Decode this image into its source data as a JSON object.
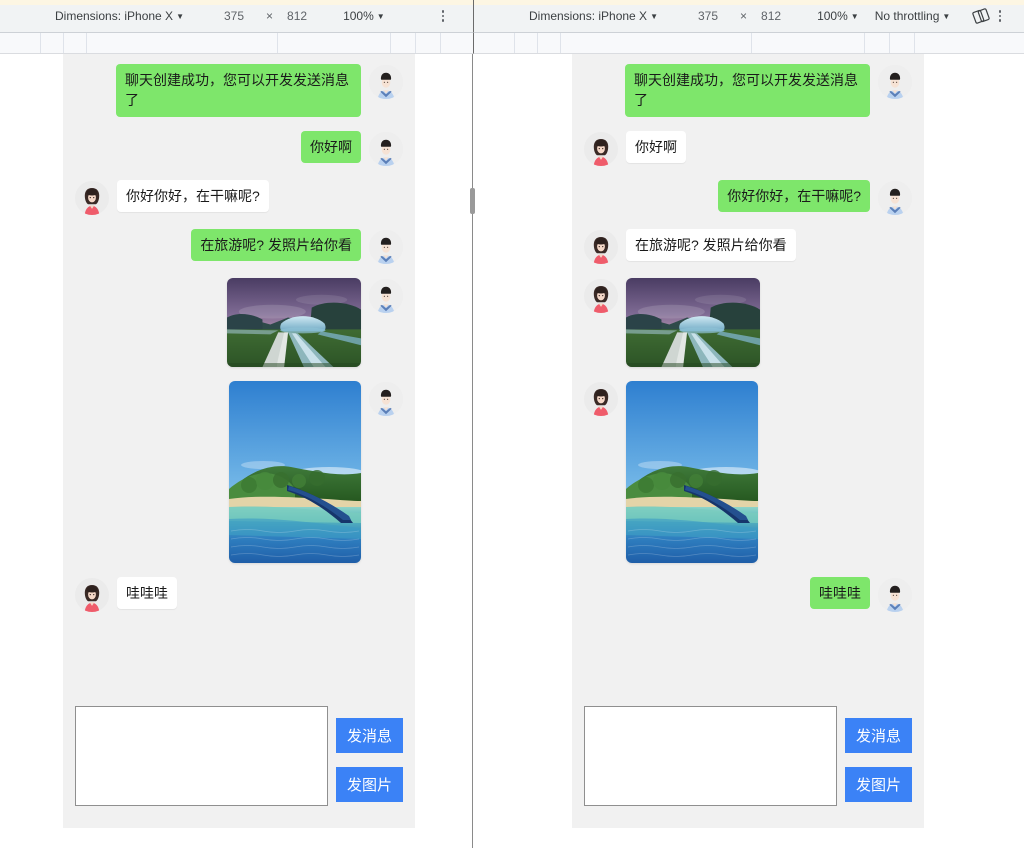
{
  "toolbars": {
    "left": {
      "dimensions_label": "Dimensions: iPhone X",
      "width": "375",
      "times": "×",
      "height": "812",
      "zoom": "100%",
      "menu_icon": "kebab-menu-icon"
    },
    "right": {
      "dimensions_label": "Dimensions: iPhone X",
      "width": "375",
      "times": "×",
      "height": "812",
      "zoom": "100%",
      "throttling": "No throttling",
      "rotate_icon": "rotate-device-icon",
      "menu_icon": "kebab-menu-icon"
    }
  },
  "colors": {
    "sent_bubble": "#7ee66b",
    "recv_bubble": "#ffffff",
    "button_blue": "#3b82f6",
    "chat_background": "#f1f1f1",
    "toolbar_background": "#f1f3f4"
  },
  "composer": {
    "input_value": "",
    "input_placeholder": "",
    "send_message_label": "发消息",
    "send_image_label": "发图片"
  },
  "panes": [
    {
      "id": "left-pane",
      "role": "sender-view",
      "messages": [
        {
          "text": "聊天创建成功，您可以开发发送消息了",
          "side": "sent",
          "type": "text",
          "avatar": "male-avatar"
        },
        {
          "text": "你好啊",
          "side": "sent",
          "type": "text",
          "avatar": "male-avatar"
        },
        {
          "text": "你好你好，在干嘛呢?",
          "side": "recv",
          "type": "text",
          "avatar": "female-avatar"
        },
        {
          "text": "在旅游呢? 发照片给你看",
          "side": "sent",
          "type": "text",
          "avatar": "male-avatar"
        },
        {
          "text": "",
          "side": "sent",
          "type": "image",
          "image": "dusk-landscape-photo",
          "avatar": "male-avatar"
        },
        {
          "text": "",
          "side": "sent",
          "type": "image",
          "image": "tropical-beach-photo",
          "avatar": "male-avatar"
        },
        {
          "text": "哇哇哇",
          "side": "recv",
          "type": "text",
          "avatar": "female-avatar"
        }
      ]
    },
    {
      "id": "right-pane",
      "role": "receiver-view",
      "messages": [
        {
          "text": "聊天创建成功，您可以开发发送消息了",
          "side": "sent",
          "type": "text",
          "avatar": "male-avatar"
        },
        {
          "text": "你好啊",
          "side": "recv",
          "type": "text",
          "avatar": "female-avatar"
        },
        {
          "text": "你好你好，在干嘛呢?",
          "side": "sent",
          "type": "text",
          "avatar": "male-avatar"
        },
        {
          "text": "在旅游呢? 发照片给你看",
          "side": "recv",
          "type": "text",
          "avatar": "female-avatar"
        },
        {
          "text": "",
          "side": "recv",
          "type": "image",
          "image": "dusk-landscape-photo",
          "avatar": "female-avatar"
        },
        {
          "text": "",
          "side": "recv",
          "type": "image",
          "image": "tropical-beach-photo",
          "avatar": "female-avatar"
        },
        {
          "text": "哇哇哇",
          "side": "sent",
          "type": "text",
          "avatar": "male-avatar"
        }
      ]
    }
  ]
}
